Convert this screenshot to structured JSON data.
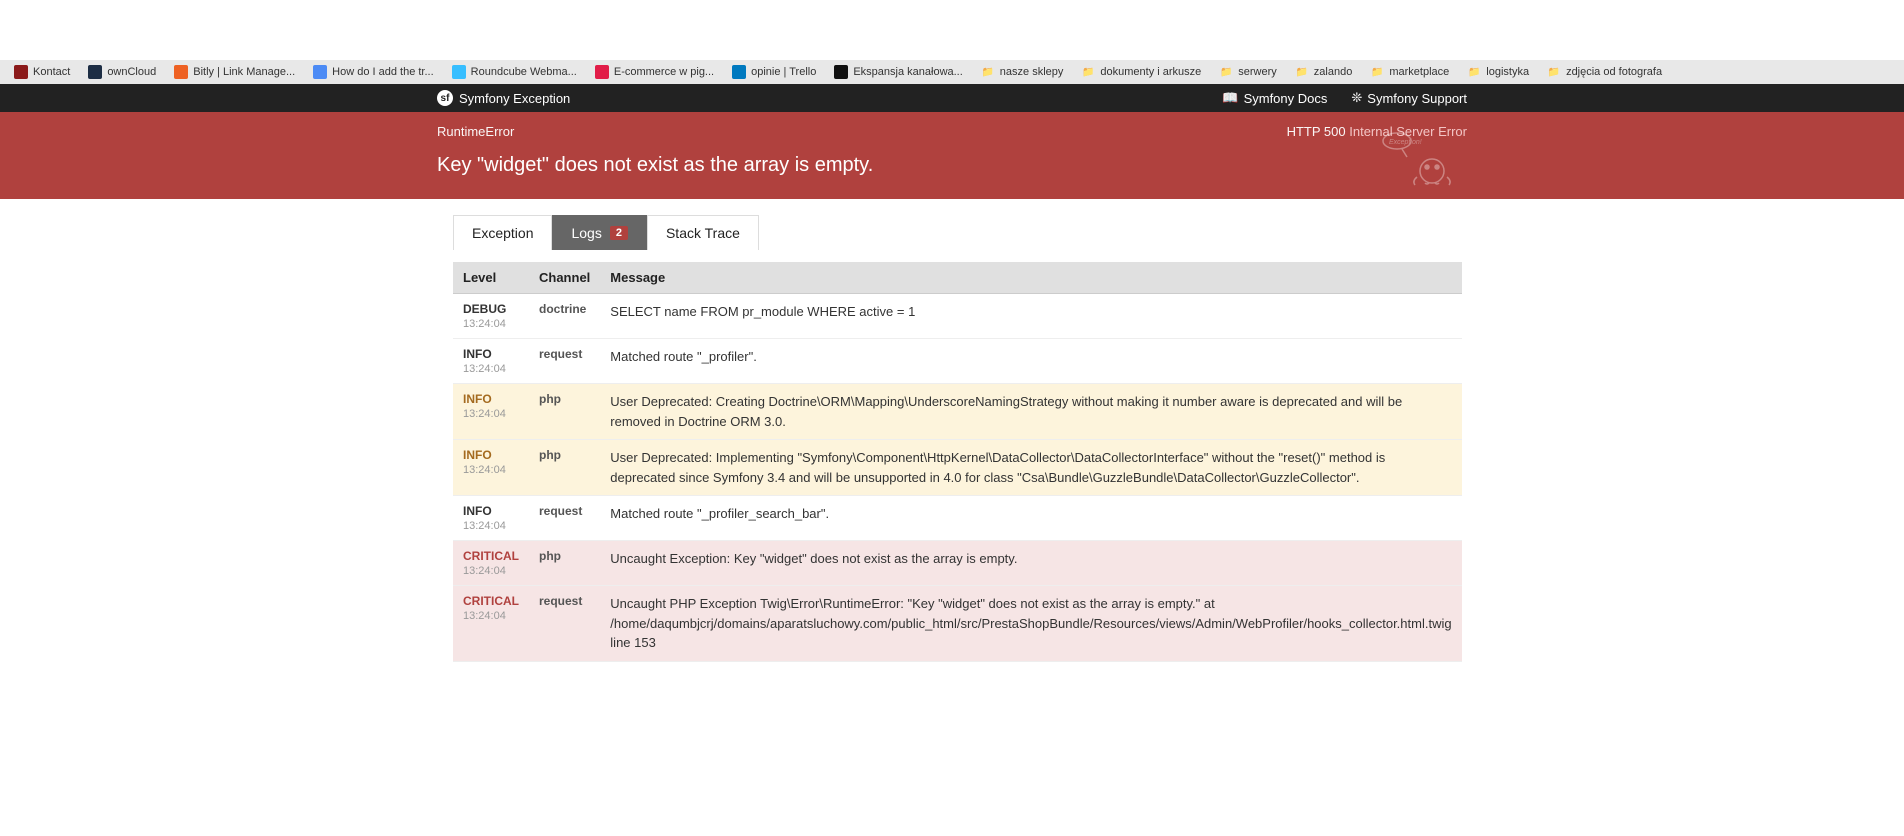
{
  "bookmarks": [
    {
      "label": "Kontact",
      "icon_color": "#8b1a1a"
    },
    {
      "label": "ownCloud",
      "icon_color": "#1d2d44"
    },
    {
      "label": "Bitly | Link Manage...",
      "icon_color": "#ee6123"
    },
    {
      "label": "How do I add the tr...",
      "icon_color": "#4c8bf5"
    },
    {
      "label": "Roundcube Webma...",
      "icon_color": "#37beff"
    },
    {
      "label": "E-commerce w pig...",
      "icon_color": "#e11d48"
    },
    {
      "label": "opinie | Trello",
      "icon_color": "#0079bf"
    },
    {
      "label": "Ekspansja kanałowa...",
      "icon_color": "#111"
    },
    {
      "label": "nasze sklepy",
      "folder": true
    },
    {
      "label": "dokumenty i arkusze",
      "folder": true
    },
    {
      "label": "serwery",
      "folder": true
    },
    {
      "label": "zalando",
      "folder": true
    },
    {
      "label": "marketplace",
      "folder": true
    },
    {
      "label": "logistyka",
      "folder": true
    },
    {
      "label": "zdjęcia od fotografa",
      "folder": true
    }
  ],
  "sf_header": {
    "title": "Symfony Exception",
    "docs": "Symfony Docs",
    "support": "Symfony Support"
  },
  "error": {
    "class": "RuntimeError",
    "http_code": "HTTP 500",
    "http_text": "Internal Server Error",
    "message": "Key \"widget\" does not exist as the array is empty."
  },
  "tabs": {
    "exception": "Exception",
    "logs": "Logs",
    "logs_badge": "2",
    "stacktrace": "Stack Trace"
  },
  "columns": {
    "level": "Level",
    "channel": "Channel",
    "message": "Message"
  },
  "logs": [
    {
      "level": "DEBUG",
      "time": "13:24:04",
      "channel": "doctrine",
      "status": "normal",
      "message": "SELECT name FROM pr_module WHERE active = 1"
    },
    {
      "level": "INFO",
      "time": "13:24:04",
      "channel": "request",
      "status": "normal",
      "message": "Matched route \"_profiler\"."
    },
    {
      "level": "INFO",
      "time": "13:24:04",
      "channel": "php",
      "status": "warning",
      "message": "User Deprecated: Creating Doctrine\\ORM\\Mapping\\UnderscoreNamingStrategy without making it number aware is deprecated and will be removed in Doctrine ORM 3.0."
    },
    {
      "level": "INFO",
      "time": "13:24:04",
      "channel": "php",
      "status": "warning",
      "message": "User Deprecated: Implementing \"Symfony\\Component\\HttpKernel\\DataCollector\\DataCollectorInterface\" without the \"reset()\" method is deprecated since Symfony 3.4 and will be unsupported in 4.0 for class \"Csa\\Bundle\\GuzzleBundle\\DataCollector\\GuzzleCollector\"."
    },
    {
      "level": "INFO",
      "time": "13:24:04",
      "channel": "request",
      "status": "normal",
      "message": "Matched route \"_profiler_search_bar\"."
    },
    {
      "level": "CRITICAL",
      "time": "13:24:04",
      "channel": "php",
      "status": "error",
      "message": "Uncaught Exception: Key \"widget\" does not exist as the array is empty."
    },
    {
      "level": "CRITICAL",
      "time": "13:24:04",
      "channel": "request",
      "status": "error",
      "message": "Uncaught PHP Exception Twig\\Error\\RuntimeError: \"Key \"widget\" does not exist as the array is empty.\" at /home/daqumbjcrj/domains/aparatsluchowy.com/public_html/src/PrestaShopBundle/Resources/views/Admin/WebProfiler/hooks_collector.html.twig line 153"
    }
  ]
}
